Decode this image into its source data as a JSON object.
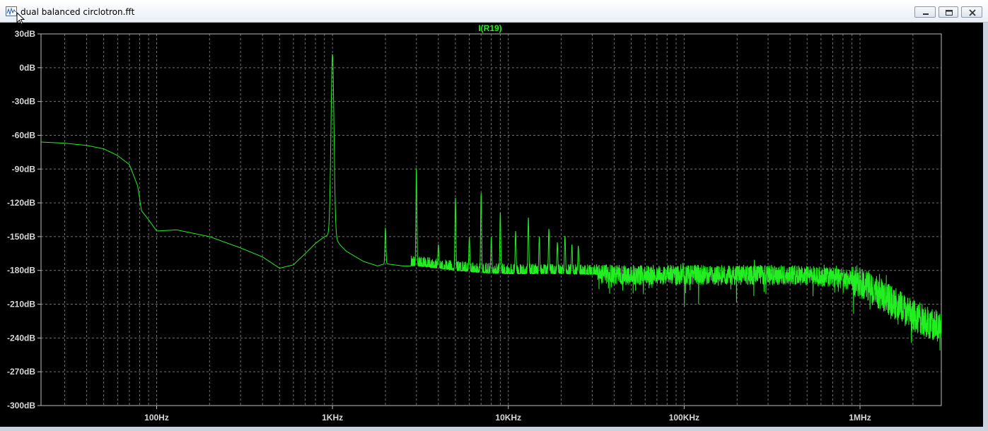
{
  "window": {
    "title": "dual balanced circlotron.fft"
  },
  "icons": {
    "app": "waveform-app-icon",
    "minimize": "minimize-icon",
    "maximize": "maximize-icon",
    "close": "close-icon",
    "cursor": "mouse-cursor-icon"
  },
  "colors": {
    "background": "#000000",
    "grid": "#707070",
    "axis_text": "#d8d8d8",
    "trace": "#22ee22"
  },
  "chart_data": {
    "type": "line",
    "title": "I(R19)",
    "xscale": "log",
    "xlim": [
      22,
      2900000
    ],
    "ylim": [
      -300,
      30
    ],
    "xticks": [
      {
        "value": 100,
        "label": "100Hz"
      },
      {
        "value": 1000,
        "label": "1KHz"
      },
      {
        "value": 10000,
        "label": "10KHz"
      },
      {
        "value": 100000,
        "label": "100KHz"
      },
      {
        "value": 1000000,
        "label": "1MHz"
      }
    ],
    "yticks": [
      {
        "value": 30,
        "label": "30dB"
      },
      {
        "value": 0,
        "label": "0dB"
      },
      {
        "value": -30,
        "label": "-30dB"
      },
      {
        "value": -60,
        "label": "-60dB"
      },
      {
        "value": -90,
        "label": "-90dB"
      },
      {
        "value": -120,
        "label": "-120dB"
      },
      {
        "value": -150,
        "label": "-150dB"
      },
      {
        "value": -180,
        "label": "-180dB"
      },
      {
        "value": -210,
        "label": "-210dB"
      },
      {
        "value": -240,
        "label": "-240dB"
      },
      {
        "value": -270,
        "label": "-270dB"
      },
      {
        "value": -300,
        "label": "-300dB"
      }
    ],
    "grid": true,
    "series": [
      {
        "color": "#22ee22",
        "envelope_x": [
          22,
          30,
          40,
          50,
          60,
          70,
          78,
          82,
          90,
          100,
          130,
          200,
          300,
          400,
          500,
          600,
          700,
          800,
          900,
          1000,
          1100,
          1200,
          1500,
          1800,
          2000,
          2500,
          3000,
          4000,
          5000,
          7000,
          10000,
          20000,
          50000,
          100000,
          200000,
          400000,
          700000,
          1000000,
          1500000,
          2000000,
          2900000
        ],
        "envelope_y": [
          -66,
          -67,
          -69,
          -72,
          -78,
          -86,
          -105,
          -127,
          -135,
          -145,
          -144,
          -150,
          -160,
          -168,
          -178,
          -175,
          -165,
          -156,
          -150,
          -147,
          -157,
          -163,
          -172,
          -176,
          -174,
          -176,
          -176,
          -178,
          -180,
          -182,
          -183,
          -183,
          -184,
          -184,
          -184,
          -184,
          -186,
          -190,
          -207,
          -220,
          -231
        ],
        "noise_band_db": 18,
        "noise_start_hz": 2800,
        "peaks": [
          {
            "x": 1000,
            "y": 12
          },
          {
            "x": 2000,
            "y": -142
          },
          {
            "x": 3000,
            "y": -89
          },
          {
            "x": 4000,
            "y": -157
          },
          {
            "x": 5000,
            "y": -115
          },
          {
            "x": 6000,
            "y": -150
          },
          {
            "x": 7000,
            "y": -111
          },
          {
            "x": 8000,
            "y": -150
          },
          {
            "x": 9000,
            "y": -128
          },
          {
            "x": 11000,
            "y": -145
          },
          {
            "x": 13000,
            "y": -133
          },
          {
            "x": 15000,
            "y": -150
          },
          {
            "x": 17000,
            "y": -143
          },
          {
            "x": 19000,
            "y": -155
          },
          {
            "x": 21000,
            "y": -149
          },
          {
            "x": 23000,
            "y": -157
          },
          {
            "x": 25000,
            "y": -158
          }
        ]
      }
    ]
  }
}
